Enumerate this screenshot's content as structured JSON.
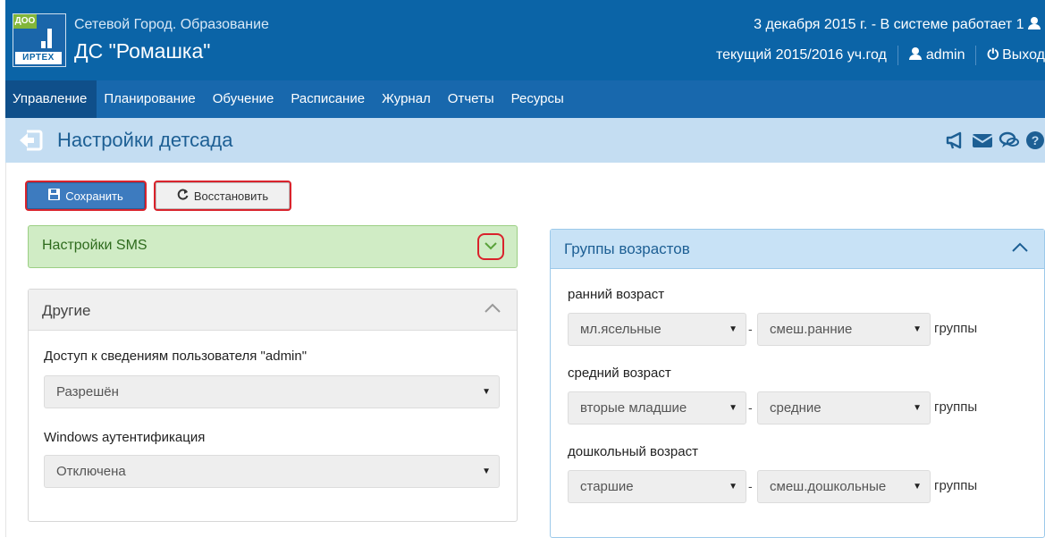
{
  "header": {
    "logo_tag": "ДОО",
    "logo_brand": "ИРТЕХ",
    "app_title": "Сетевой Город. Образование",
    "org_name": "ДС \"Ромашка\"",
    "date_status": "3 декабря 2015 г. - В системе работает 1",
    "school_year": "текущий 2015/2016 уч.год",
    "user": "admin",
    "logout": "Выход"
  },
  "nav": {
    "items": [
      "Управление",
      "Планирование",
      "Обучение",
      "Расписание",
      "Журнал",
      "Отчеты",
      "Ресурсы"
    ],
    "active_index": 0
  },
  "page": {
    "title": "Настройки детсада"
  },
  "toolbar": {
    "save_label": "Сохранить",
    "restore_label": "Восстановить"
  },
  "sms_panel": {
    "title": "Настройки SMS"
  },
  "other_panel": {
    "title": "Другие",
    "access_label": "Доступ к сведениям пользователя \"admin\"",
    "access_value": "Разрешён",
    "windows_auth_label": "Windows аутентификация",
    "windows_auth_value": "Отключена"
  },
  "age_groups": {
    "title": "Группы возрастов",
    "groups_suffix": "группы",
    "rows": [
      {
        "label": "ранний возраст",
        "from": "мл.ясельные",
        "to": "смеш.ранние"
      },
      {
        "label": "средний возраст",
        "from": "вторые младшие",
        "to": "средние"
      },
      {
        "label": "дошкольный возраст",
        "from": "старшие",
        "to": "смеш.дошкольные"
      }
    ]
  },
  "colors": {
    "header_bg": "#0b64a7",
    "nav_bg": "#1868ad",
    "nav_active": "#0f4f8a",
    "subheader_bg": "#c4ddf2",
    "sms_panel_bg": "#d0ecc5",
    "highlight_red": "#d9232c"
  },
  "icons": {
    "save": "floppy-icon",
    "restore": "refresh-icon",
    "back": "back-arrow-icon",
    "header_tools": [
      "megaphone-icon",
      "mail-icon",
      "chat-icon",
      "help-icon"
    ]
  }
}
